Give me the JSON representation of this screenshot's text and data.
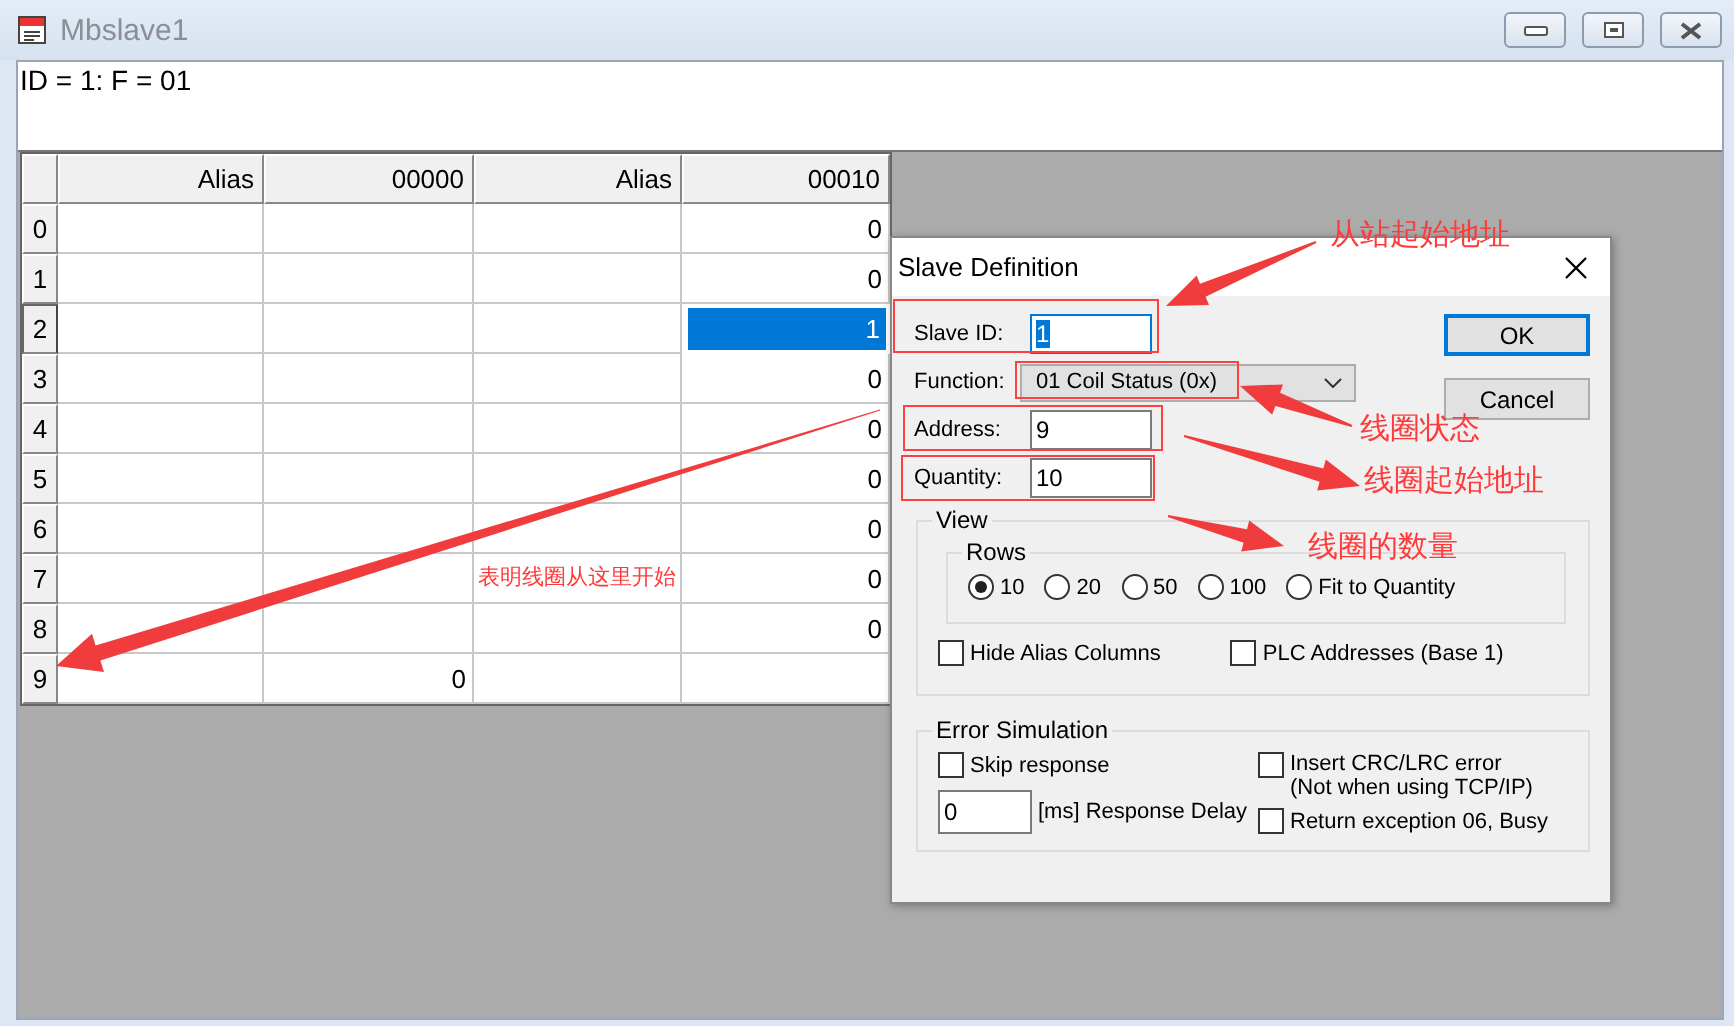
{
  "window": {
    "title": "Mbslave1"
  },
  "status_line": "ID = 1: F = 01",
  "table": {
    "columns": [
      "Alias",
      "00000",
      "Alias",
      "00010"
    ],
    "rows": [
      {
        "label": "0",
        "selected": false,
        "cells": [
          {
            "selected": false
          },
          {
            "selected": false
          },
          {
            "selected": false
          },
          {
            "text": "0",
            "selected": false
          }
        ]
      },
      {
        "label": "1",
        "selected": false,
        "cells": [
          {
            "selected": false
          },
          {
            "selected": false
          },
          {
            "selected": false
          },
          {
            "text": "0",
            "selected": false
          }
        ]
      },
      {
        "label": "2",
        "selected": true,
        "cells": [
          {
            "selected": false
          },
          {
            "selected": false
          },
          {
            "selected": false
          },
          {
            "text": "1",
            "selected": true
          }
        ]
      },
      {
        "label": "3",
        "selected": false,
        "cells": [
          {
            "selected": false
          },
          {
            "selected": false
          },
          {
            "selected": false
          },
          {
            "text": "0",
            "selected": false
          }
        ]
      },
      {
        "label": "4",
        "selected": false,
        "cells": [
          {
            "selected": false
          },
          {
            "selected": false
          },
          {
            "selected": false
          },
          {
            "text": "0",
            "selected": false
          }
        ]
      },
      {
        "label": "5",
        "selected": false,
        "cells": [
          {
            "selected": false
          },
          {
            "selected": false
          },
          {
            "selected": false
          },
          {
            "text": "0",
            "selected": false
          }
        ]
      },
      {
        "label": "6",
        "selected": false,
        "cells": [
          {
            "selected": false
          },
          {
            "selected": false
          },
          {
            "selected": false
          },
          {
            "text": "0",
            "selected": false
          }
        ]
      },
      {
        "label": "7",
        "selected": false,
        "cells": [
          {
            "selected": false
          },
          {
            "selected": false
          },
          {
            "selected": false
          },
          {
            "text": "0",
            "selected": false
          }
        ]
      },
      {
        "label": "8",
        "selected": false,
        "cells": [
          {
            "selected": false
          },
          {
            "selected": false
          },
          {
            "selected": false
          },
          {
            "text": "0",
            "selected": false
          }
        ]
      },
      {
        "label": "9",
        "selected": false,
        "cells": [
          {
            "selected": false
          },
          {
            "text": "0",
            "selected": false
          },
          {
            "selected": false
          },
          {
            "selected": false
          }
        ]
      }
    ]
  },
  "dialog": {
    "title": "Slave Definition",
    "fields": [
      {
        "label": "Slave ID:",
        "value": "1",
        "kind": "input",
        "focused": true
      },
      {
        "label": "Function:",
        "value": "01 Coil Status (0x)",
        "kind": "select",
        "focused": false
      },
      {
        "label": "Address:",
        "value": "9",
        "kind": "input",
        "focused": false
      },
      {
        "label": "Quantity:",
        "value": "10",
        "kind": "input",
        "focused": false
      }
    ],
    "buttons": [
      {
        "label": "OK",
        "default": true
      },
      {
        "label": "Cancel",
        "default": false
      }
    ],
    "view": {
      "title": "View",
      "rows_title": "Rows",
      "row_options": [
        {
          "label": "10",
          "selected": true
        },
        {
          "label": "20",
          "selected": false
        },
        {
          "label": "50",
          "selected": false
        },
        {
          "label": "100",
          "selected": false
        },
        {
          "label": "Fit to Quantity",
          "selected": false
        }
      ],
      "checkboxes": [
        {
          "label": "Hide Alias Columns",
          "checked": false
        },
        {
          "label": "PLC Addresses (Base 1)",
          "checked": false
        }
      ]
    },
    "error_simulation": {
      "title": "Error Simulation",
      "skip_response": {
        "label": "Skip response",
        "checked": false
      },
      "delay": {
        "value": "0",
        "label": "[ms] Response Delay"
      },
      "insert_crc": {
        "label": "Insert CRC/LRC error",
        "note": "(Not when using TCP/IP)",
        "checked": false
      },
      "return_exception": {
        "label": "Return exception 06, Busy",
        "checked": false
      }
    }
  },
  "annotations": [
    {
      "text": "从站起始地址"
    },
    {
      "text": "线圈状态"
    },
    {
      "text": "线圈起始地址"
    },
    {
      "text": "线圈的数量"
    },
    {
      "text": "表明线圈从这里开始"
    }
  ]
}
